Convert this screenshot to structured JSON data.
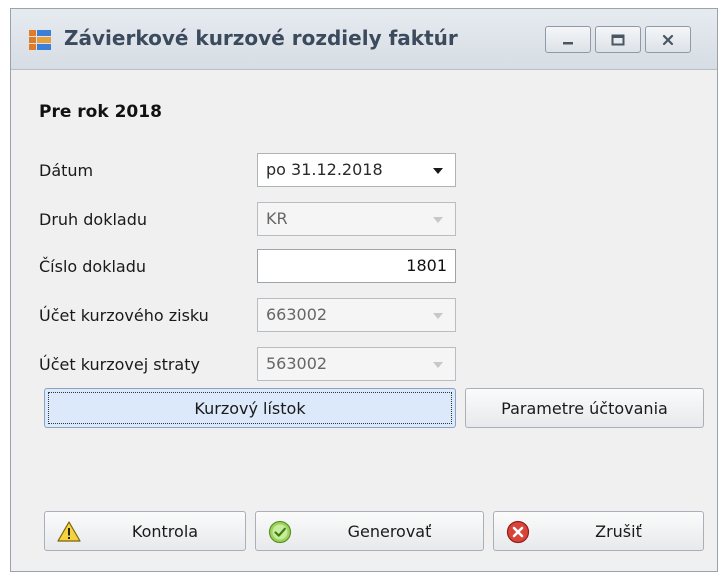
{
  "window": {
    "title": "Závierkové kurzové rozdiely faktúr",
    "controls": [
      "minimize-icon",
      "maximize-icon",
      "close-icon"
    ]
  },
  "form": {
    "heading": "Pre rok 2018",
    "fields": {
      "datum": {
        "label": "Dátum",
        "value": "po 31.12.2018"
      },
      "druh_dokladu": {
        "label": "Druh dokladu",
        "value": "KR"
      },
      "cislo_dokladu": {
        "label": "Číslo dokladu",
        "value": "1801"
      },
      "ucet_zisku": {
        "label": "Účet kurzového zisku",
        "value": "663002"
      },
      "ucet_straty": {
        "label": "Účet kurzovej straty",
        "value": "563002"
      }
    }
  },
  "buttons": {
    "kurzovy_listok": "Kurzový lístok",
    "parametre": "Parametre účtovania",
    "kontrola": "Kontrola",
    "generovat": "Generovať",
    "zrusit": "Zrušiť"
  },
  "icons": {
    "kontrola": "warning-icon",
    "generovat": "check-icon",
    "zrusit": "cancel-icon"
  },
  "colors": {
    "focused_button": "#dce9fb",
    "title_text": "#3b4a5c"
  }
}
